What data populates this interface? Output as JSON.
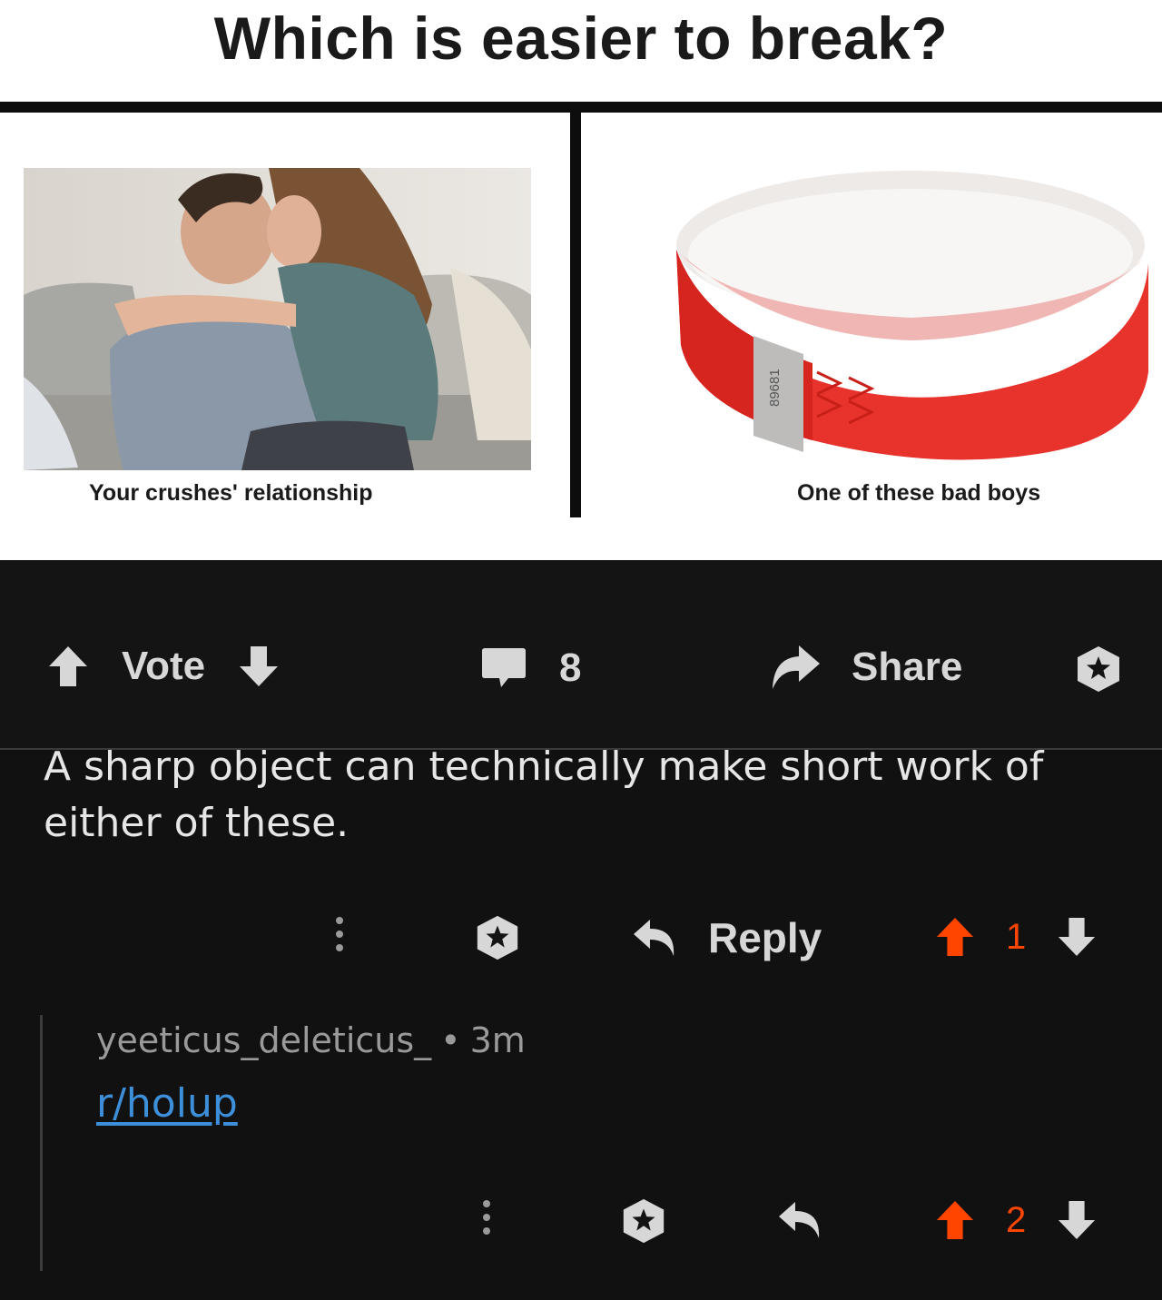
{
  "meme": {
    "title": "Which is easier to break?",
    "left_caption": "Your crushes' relationship",
    "right_caption": "One of these bad boys",
    "wristband_number": "89681"
  },
  "post_actions": {
    "vote_label": "Vote",
    "comment_count": "8",
    "share_label": "Share"
  },
  "comment": {
    "body": "A sharp object can technically make short work of either of these.",
    "reply_label": "Reply",
    "score": "1"
  },
  "reply": {
    "username": "yeeticus_deleticus_",
    "separator": "•",
    "age": "3m",
    "body": "r/holup",
    "score": "2"
  },
  "colors": {
    "background": "#141414",
    "upvote_active": "#ff4500",
    "link": "#3d8fd9",
    "wristband": "#e8322c"
  }
}
